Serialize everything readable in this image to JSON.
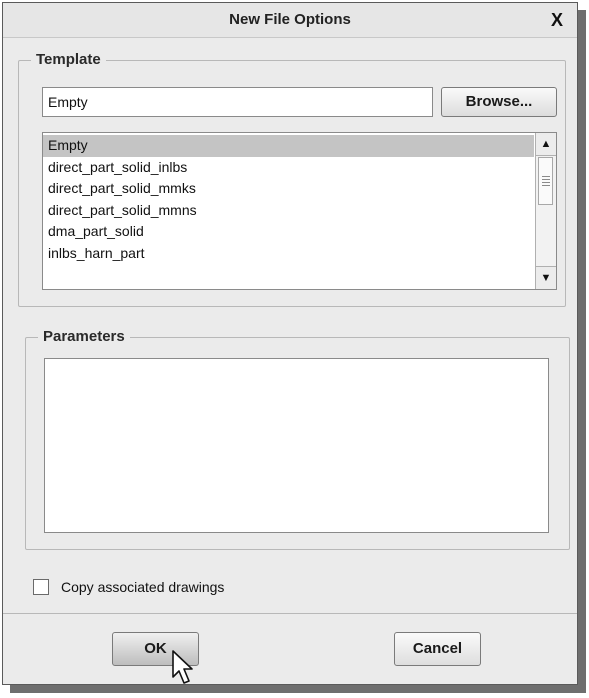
{
  "dialog": {
    "title": "New File Options",
    "close_label": "X"
  },
  "template": {
    "legend": "Template",
    "field_value": "Empty",
    "browse_label": "Browse...",
    "items": [
      {
        "label": "Empty",
        "selected": true
      },
      {
        "label": "direct_part_solid_inlbs"
      },
      {
        "label": "direct_part_solid_mmks"
      },
      {
        "label": "direct_part_solid_mmns"
      },
      {
        "label": "dma_part_solid"
      },
      {
        "label": "inlbs_harn_part"
      }
    ]
  },
  "parameters": {
    "legend": "Parameters"
  },
  "copy_drawings": {
    "label": "Copy associated drawings",
    "checked": false
  },
  "buttons": {
    "ok_label": "OK",
    "cancel_label": "Cancel"
  },
  "icons": {
    "scroll_up": "triangle-up-icon",
    "scroll_down": "triangle-down-icon",
    "cursor": "mouse-pointer-icon"
  }
}
